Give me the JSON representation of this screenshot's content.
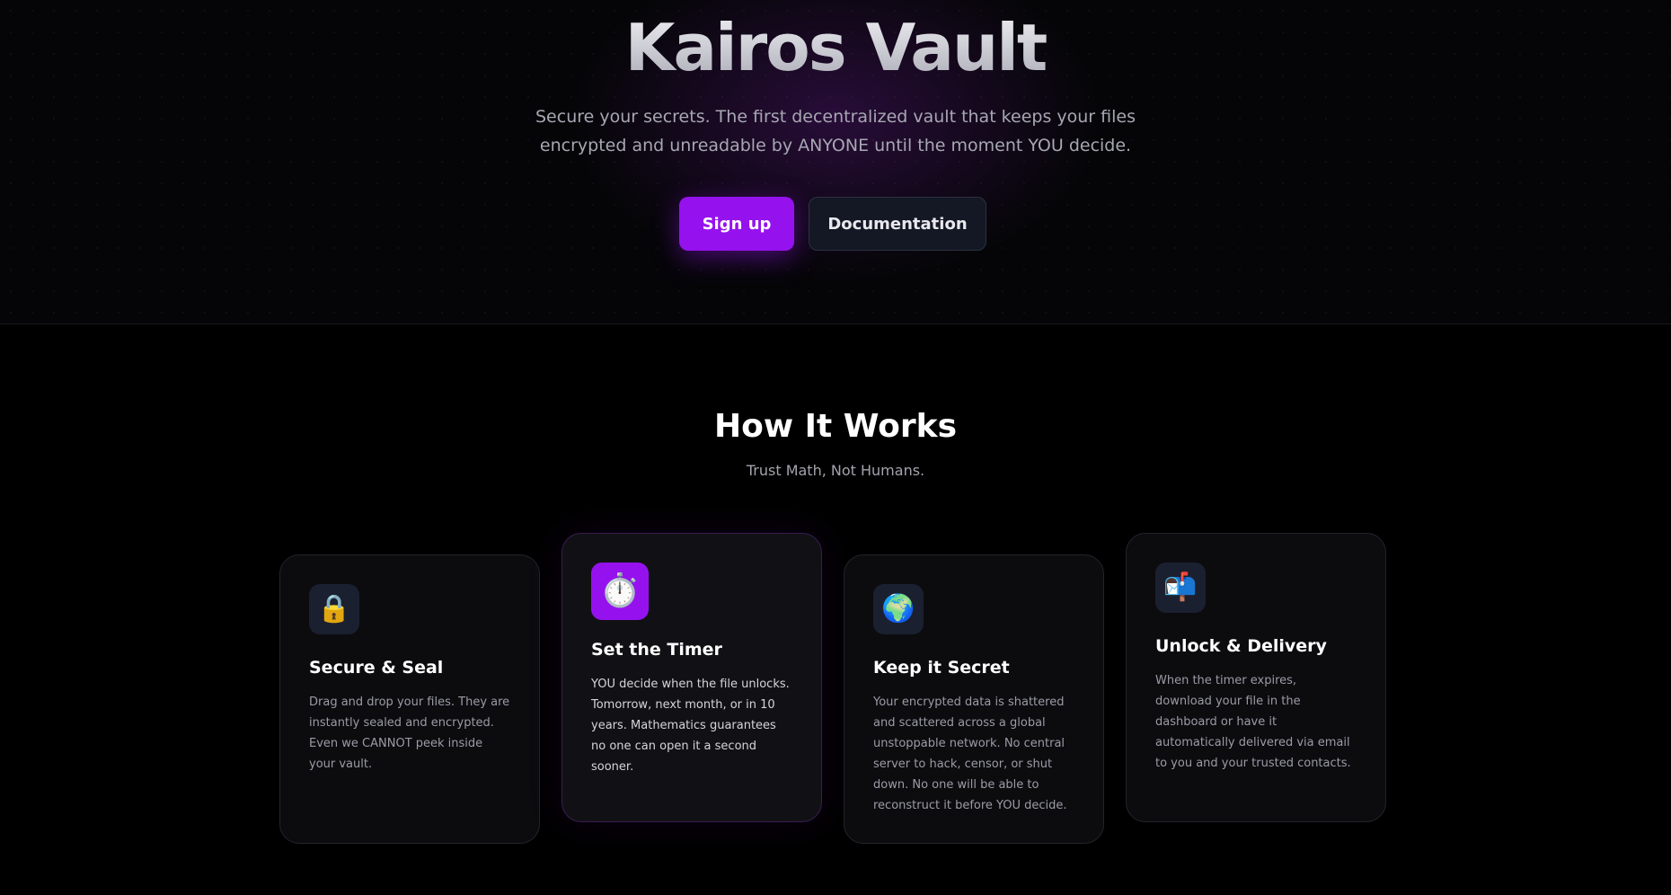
{
  "hero": {
    "title": "Kairos Vault",
    "subtitle_line1": "Secure your secrets. The first decentralized vault that keeps your files",
    "subtitle_line2": "encrypted and unreadable by ANYONE until the moment YOU decide.",
    "primary_button": "Sign up",
    "secondary_button": "Documentation"
  },
  "how_it_works": {
    "title": "How It Works",
    "subtitle": "Trust Math, Not Humans.",
    "cards": [
      {
        "icon": "lock-icon",
        "glyph": "🔒",
        "title": "Secure & Seal",
        "text": "Drag and drop your files. They are instantly sealed and encrypted. Even we CANNOT peek inside your vault."
      },
      {
        "icon": "stopwatch-icon",
        "glyph": "⏱️",
        "title": "Set the Timer",
        "text": "YOU decide when the file unlocks. Tomorrow, next month, or in 10 years. Mathematics guarantees no one can open it a second sooner."
      },
      {
        "icon": "globe-icon",
        "glyph": "🌍",
        "title": "Keep it Secret",
        "text": "Your encrypted data is shattered and scattered across a global unstoppable network. No central server to hack, censor, or shut down. No one will be able to reconstruct it before YOU decide."
      },
      {
        "icon": "mailbox-icon",
        "glyph": "📬",
        "title": "Unlock & Delivery",
        "text": "When the timer expires, download your file in the dashboard or have it automatically delivered via email to you and your trusted contacts."
      }
    ]
  },
  "colors": {
    "accent": "#9512ee",
    "background": "#000000",
    "card_background": "#0c0c0f",
    "icon_background": "#1b2030"
  }
}
